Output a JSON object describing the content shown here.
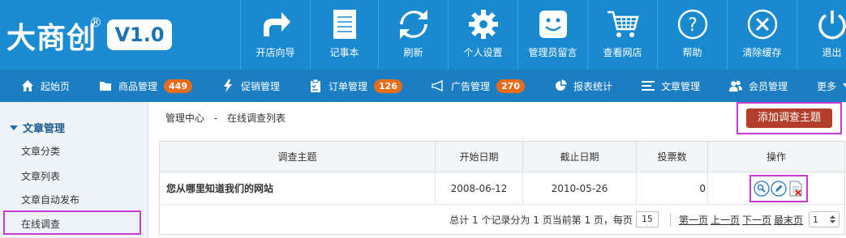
{
  "brand": {
    "logo_text": "大商创",
    "registered": "®",
    "version": "V1.0"
  },
  "top_nav": [
    {
      "label": "开店向导",
      "icon": "share-arrow-icon"
    },
    {
      "label": "记事本",
      "icon": "notepad-icon"
    },
    {
      "label": "刷新",
      "icon": "refresh-icon"
    },
    {
      "label": "个人设置",
      "icon": "gear-icon"
    },
    {
      "label": "管理员留言",
      "icon": "smiley-message-icon"
    },
    {
      "label": "查看网店",
      "icon": "cart-icon"
    },
    {
      "label": "帮助",
      "icon": "help-icon"
    },
    {
      "label": "清除缓存",
      "icon": "clear-icon"
    },
    {
      "label": "退出",
      "icon": "power-icon"
    }
  ],
  "sub_nav": [
    {
      "label": "起始页",
      "icon": "home-icon",
      "badge": null
    },
    {
      "label": "商品管理",
      "icon": "folder-icon",
      "badge": "449"
    },
    {
      "label": "促销管理",
      "icon": "lightning-icon",
      "badge": null
    },
    {
      "label": "订单管理",
      "icon": "clipboard-icon",
      "badge": "126"
    },
    {
      "label": "广告管理",
      "icon": "megaphone-icon",
      "badge": "270"
    },
    {
      "label": "报表统计",
      "icon": "pie-chart-icon",
      "badge": null
    },
    {
      "label": "文章管理",
      "icon": "list-icon",
      "badge": null
    },
    {
      "label": "会员管理",
      "icon": "users-icon",
      "badge": null
    },
    {
      "label": "更多",
      "icon": "caret-down-icon",
      "badge": null
    }
  ],
  "sidebar": {
    "section_title": "文章管理",
    "items": [
      "文章分类",
      "文章列表",
      "文章自动发布",
      "在线调查"
    ],
    "active": "在线调查"
  },
  "breadcrumb": {
    "root": "管理中心",
    "separator": "-",
    "current": "在线调查列表"
  },
  "add_button": "添加调查主题",
  "table": {
    "headers": [
      "调查主题",
      "开始日期",
      "截止日期",
      "投票数",
      "操作"
    ],
    "rows": [
      {
        "subject": "您从哪里知道我们的网站",
        "start": "2008-06-12",
        "end": "2010-05-26",
        "votes": "0"
      }
    ]
  },
  "pager": {
    "summary": "总计 1 个记录分为 1 页当前第 1 页，每页",
    "per_page": "15",
    "first": "第一页",
    "prev": "上一页",
    "next": "下一页",
    "last": "最末页",
    "page_select": "1"
  },
  "colors": {
    "header_blue": "#1a8ad0",
    "subnav_blue": "#1c7ec2",
    "badge_orange": "#e96c1a",
    "button_red": "#b43e2b",
    "highlight_magenta": "#c53bd1"
  }
}
